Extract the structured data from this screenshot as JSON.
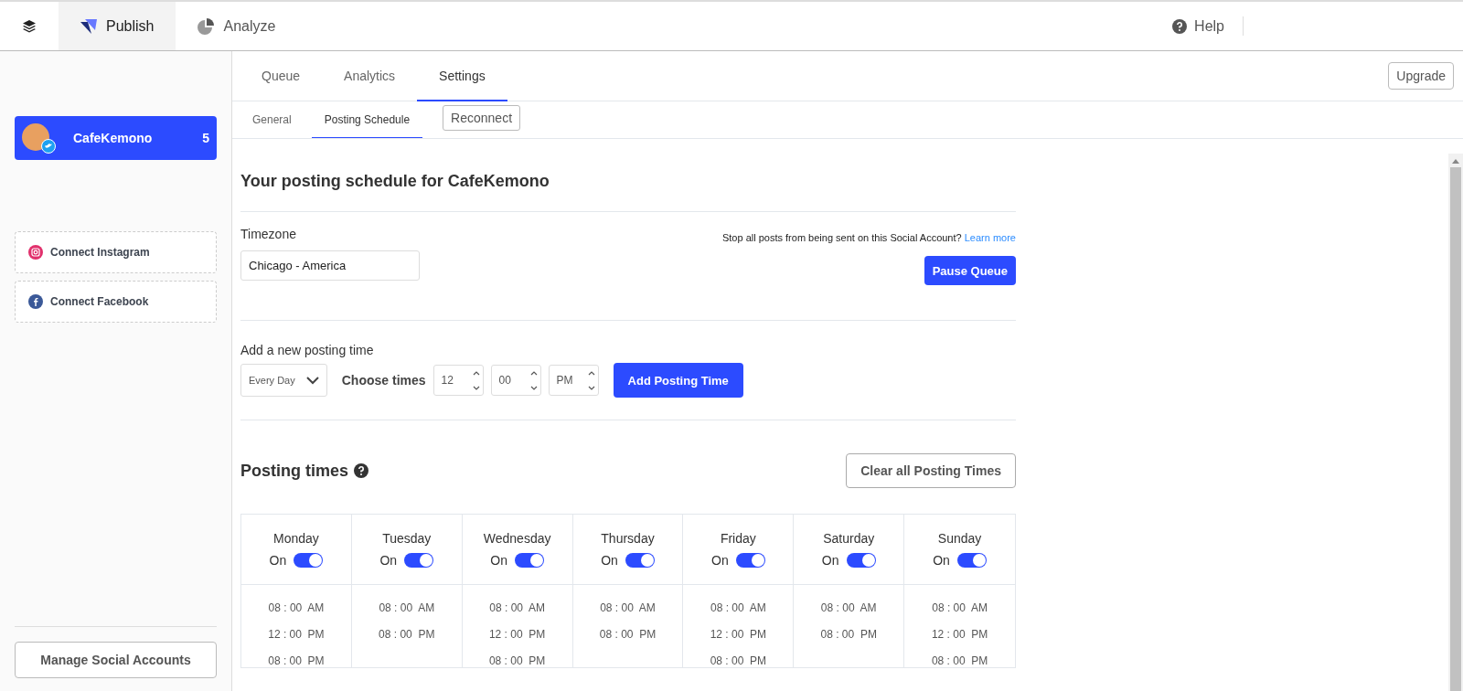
{
  "topbar": {
    "tabs": [
      {
        "label": "Publish",
        "selected": true
      },
      {
        "label": "Analyze",
        "selected": false
      }
    ],
    "help": "Help"
  },
  "sidebar": {
    "account": {
      "name": "CafeKemono",
      "count": "5",
      "selected": true
    },
    "connect": [
      {
        "kind": "instagram",
        "label": "Connect Instagram"
      },
      {
        "kind": "facebook",
        "label": "Connect Facebook"
      }
    ],
    "manage_button": "Manage Social Accounts"
  },
  "tabs": [
    {
      "label": "Queue",
      "selected": false
    },
    {
      "label": "Analytics",
      "selected": false
    },
    {
      "label": "Settings",
      "selected": true
    }
  ],
  "upgrade_button": "Upgrade",
  "subtabs": [
    {
      "label": "General",
      "selected": false
    },
    {
      "label": "Posting Schedule",
      "selected": true
    }
  ],
  "reconnect_button": "Reconnect",
  "schedule": {
    "title": "Your posting schedule for CafeKemono",
    "timezone_label": "Timezone",
    "timezone": "Chicago - America",
    "pause_note": "Stop all posts from being sent on this Social Account?",
    "learn_more": "Learn more",
    "pause_button": "Pause Queue",
    "add_label": "Add a new posting time",
    "day_select": "Every Day",
    "choose_label": "Choose times",
    "hour": "12",
    "minute": "00",
    "period": "PM",
    "add_button": "Add Posting Time",
    "times_title": "Posting times",
    "clear_button": "Clear all Posting Times",
    "days": [
      {
        "name": "Monday",
        "toggle_label": "On",
        "on": true,
        "times": [
          "08 : 00  AM",
          "12 : 00  PM",
          "08 : 00  PM"
        ]
      },
      {
        "name": "Tuesday",
        "toggle_label": "On",
        "on": true,
        "times": [
          "08 : 00  AM",
          "08 : 00  PM"
        ]
      },
      {
        "name": "Wednesday",
        "toggle_label": "On",
        "on": true,
        "times": [
          "08 : 00  AM",
          "12 : 00  PM",
          "08 : 00  PM"
        ]
      },
      {
        "name": "Thursday",
        "toggle_label": "On",
        "on": true,
        "times": [
          "08 : 00  AM",
          "08 : 00  PM"
        ]
      },
      {
        "name": "Friday",
        "toggle_label": "On",
        "on": true,
        "times": [
          "08 : 00  AM",
          "12 : 00  PM",
          "08 : 00  PM"
        ]
      },
      {
        "name": "Saturday",
        "toggle_label": "On",
        "on": true,
        "times": [
          "08 : 00  AM",
          "08 : 00  PM"
        ]
      },
      {
        "name": "Sunday",
        "toggle_label": "On",
        "on": true,
        "times": [
          "08 : 00  AM",
          "12 : 00  PM",
          "08 : 00  PM"
        ]
      }
    ]
  }
}
